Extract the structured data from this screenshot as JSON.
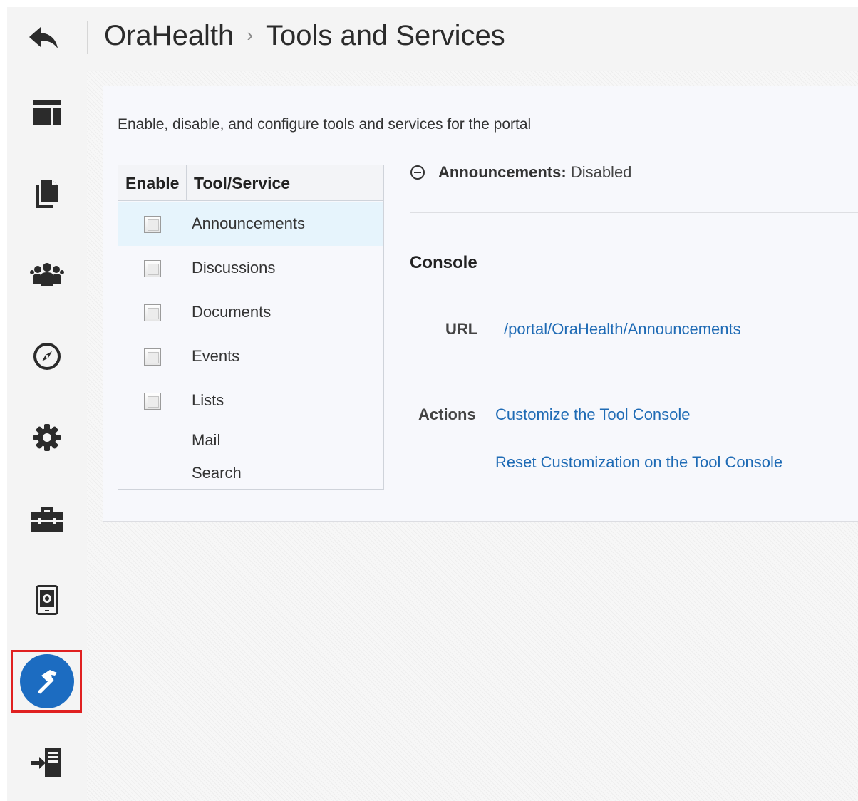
{
  "header": {
    "back_icon": "back-arrow-icon",
    "breadcrumb_root": "OraHealth",
    "breadcrumb_separator": "›",
    "breadcrumb_current": "Tools and Services"
  },
  "sidebar": {
    "items": [
      {
        "icon": "layout-icon"
      },
      {
        "icon": "documents-icon"
      },
      {
        "icon": "people-icon"
      },
      {
        "icon": "compass-icon"
      },
      {
        "icon": "gear-icon"
      },
      {
        "icon": "toolbox-icon"
      },
      {
        "icon": "device-settings-icon"
      },
      {
        "icon": "hammer-icon",
        "active": true
      },
      {
        "icon": "import-icon"
      }
    ],
    "active_color": "#1c6cc1",
    "highlight_color": "#e02020"
  },
  "main": {
    "description": "Enable, disable, and configure tools and services for the portal",
    "tool_table": {
      "headers": {
        "enable": "Enable",
        "tool": "Tool/Service"
      },
      "rows": [
        {
          "label": "Announcements",
          "has_checkbox": true,
          "checked": false,
          "selected": true
        },
        {
          "label": "Discussions",
          "has_checkbox": true,
          "checked": false
        },
        {
          "label": "Documents",
          "has_checkbox": true,
          "checked": false
        },
        {
          "label": "Events",
          "has_checkbox": true,
          "checked": false
        },
        {
          "label": "Lists",
          "has_checkbox": true,
          "checked": false
        },
        {
          "label": "Mail",
          "has_checkbox": false
        },
        {
          "label": "Search",
          "has_checkbox": false
        }
      ]
    },
    "details": {
      "title": "Announcements:",
      "status": "Disabled",
      "console_heading": "Console",
      "url_label": "URL",
      "url_value": "/portal/OraHealth/Announcements",
      "actions_label": "Actions",
      "actions": [
        "Customize the Tool Console",
        "Reset Customization on the Tool Console"
      ],
      "link_color": "#1f6bb5"
    }
  }
}
